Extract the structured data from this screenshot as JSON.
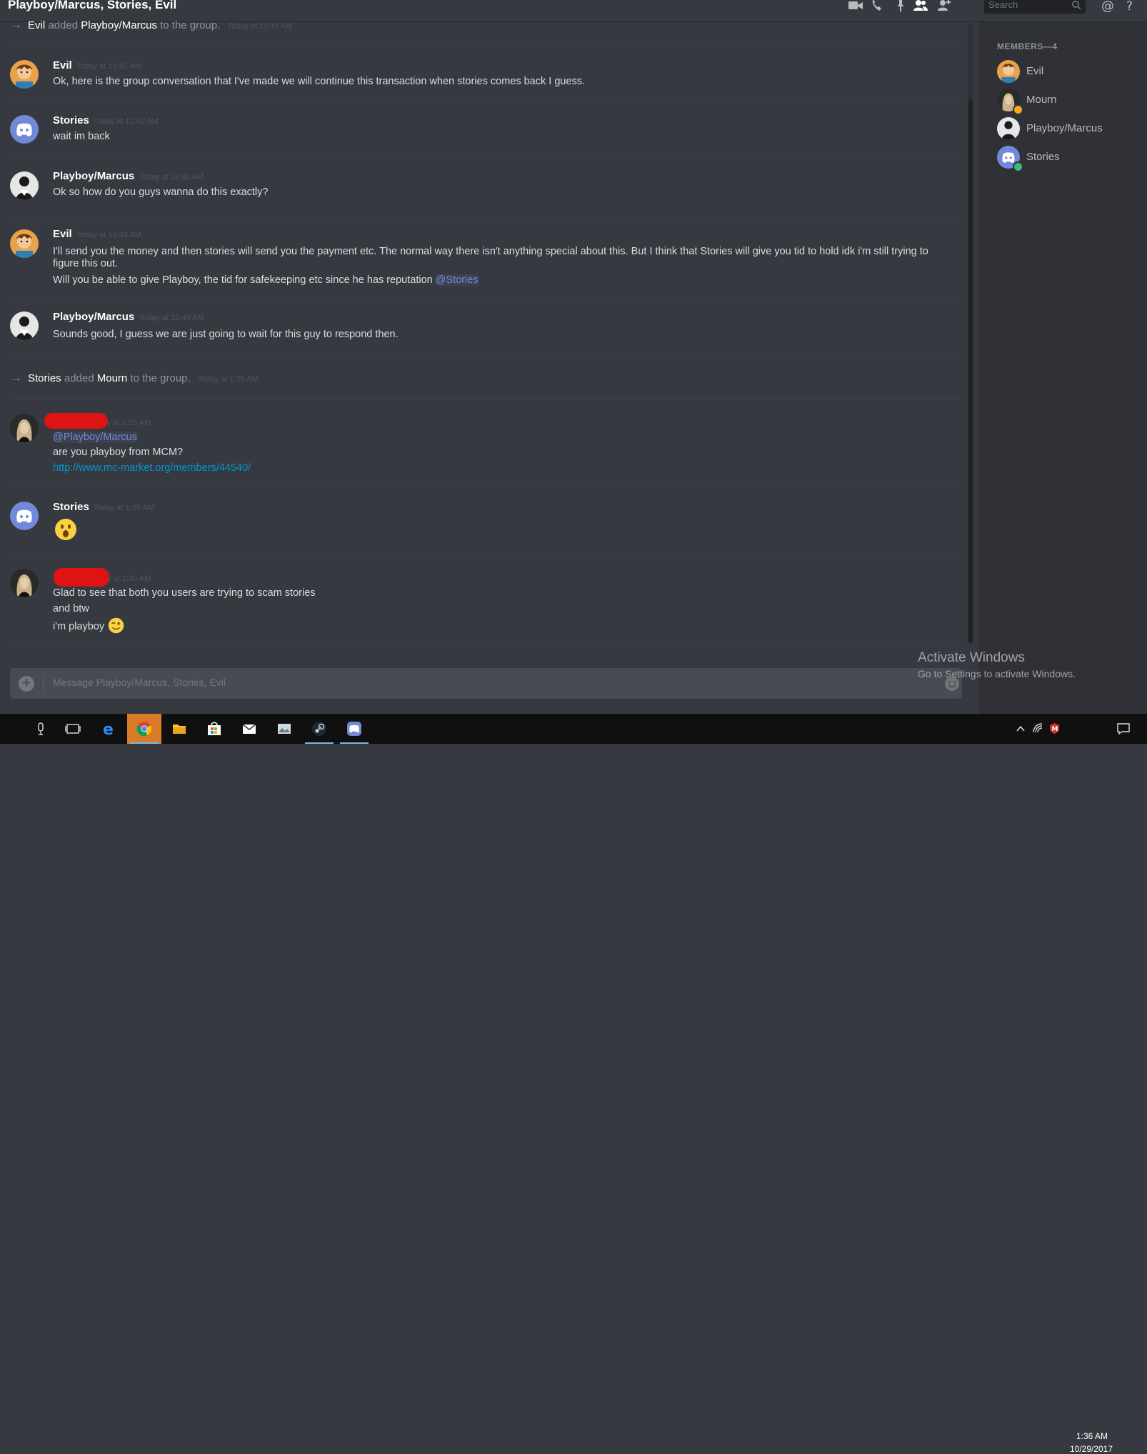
{
  "titlebar": {
    "title": "Playboy/Marcus, Stories, Evil",
    "search_placeholder": "Search"
  },
  "chat": {
    "sys1": {
      "actor": "Evil",
      "action": "added",
      "target": "Playboy/Marcus",
      "suffix": "to the group.",
      "time": "Today at 12:41 AM"
    },
    "m1": {
      "author": "Evil",
      "time": "Today at 12:42 AM",
      "text": "Ok, here is the group conversation that I've made we will continue this transaction when stories comes back I guess."
    },
    "m2": {
      "author": "Stories",
      "time": "Today at 12:42 AM",
      "text": "wait im back"
    },
    "m3": {
      "author": "Playboy/Marcus",
      "time": "Today at 12:42 AM",
      "text": "Ok so how do you guys wanna do this exactly?"
    },
    "m4": {
      "author": "Evil",
      "time": "Today at 12:43 AM",
      "line1": "I'll send you the money and then stories will send you the payment etc. The normal way there isn't anything special about this. But I think that Stories will give you tid to hold idk i'm still trying to",
      "line2": "figure this out.",
      "line3": "Will you be able to give  Playboy, the tid for safekeeping etc since he has reputation",
      "mention": "@Stories"
    },
    "m5": {
      "author": "Playboy/Marcus",
      "time": "Today at 12:43 AM",
      "text": "Sounds good, I guess we are just going to wait for this guy to respond then."
    },
    "sys2": {
      "actor": "Stories",
      "action": "added",
      "target": "Mourn",
      "suffix": "to the group.",
      "time": "Today at 1:25 AM"
    },
    "m6": {
      "time_partial": "y at 1:25 AM",
      "mention": "@Playboy/Marcus",
      "text": "are you playboy from MCM?",
      "link": "http://www.mc-market.org/members/44540/"
    },
    "m7": {
      "author": "Stories",
      "time": "Today at 1:29 AM",
      "emoji": "astonished-emoji"
    },
    "m8": {
      "time_partial": "y at 1:30 AM",
      "line1": "Glad to see that both you users are trying to scam stories",
      "line2": "and btw",
      "line3": "i'm playboy",
      "emoji": "wink-emoji"
    }
  },
  "composer": {
    "placeholder": "Message Playboy/Marcus, Stories, Evil"
  },
  "members": {
    "header": "MEMBERS—4",
    "list": [
      {
        "name": "Evil",
        "status": "none"
      },
      {
        "name": "Mourn",
        "status": "idle"
      },
      {
        "name": "Playboy/Marcus",
        "status": "none"
      },
      {
        "name": "Stories",
        "status": "online"
      }
    ]
  },
  "watermark": {
    "title": "Activate Windows",
    "subtitle": "Go to Settings to activate Windows."
  },
  "taskbar": {
    "apps": [
      "microphone-icon",
      "task-view-icon",
      "edge-icon",
      "chrome-icon",
      "file-explorer-icon",
      "store-icon",
      "mail-icon",
      "photo-app-icon",
      "steam-icon",
      "discord-icon"
    ],
    "time": "1:36 AM",
    "date": "10/29/2017"
  },
  "colors": {
    "accent": "#7289da",
    "online": "#43b581",
    "idle": "#faa61a",
    "link": "#0096cf",
    "background": "#36393f"
  }
}
